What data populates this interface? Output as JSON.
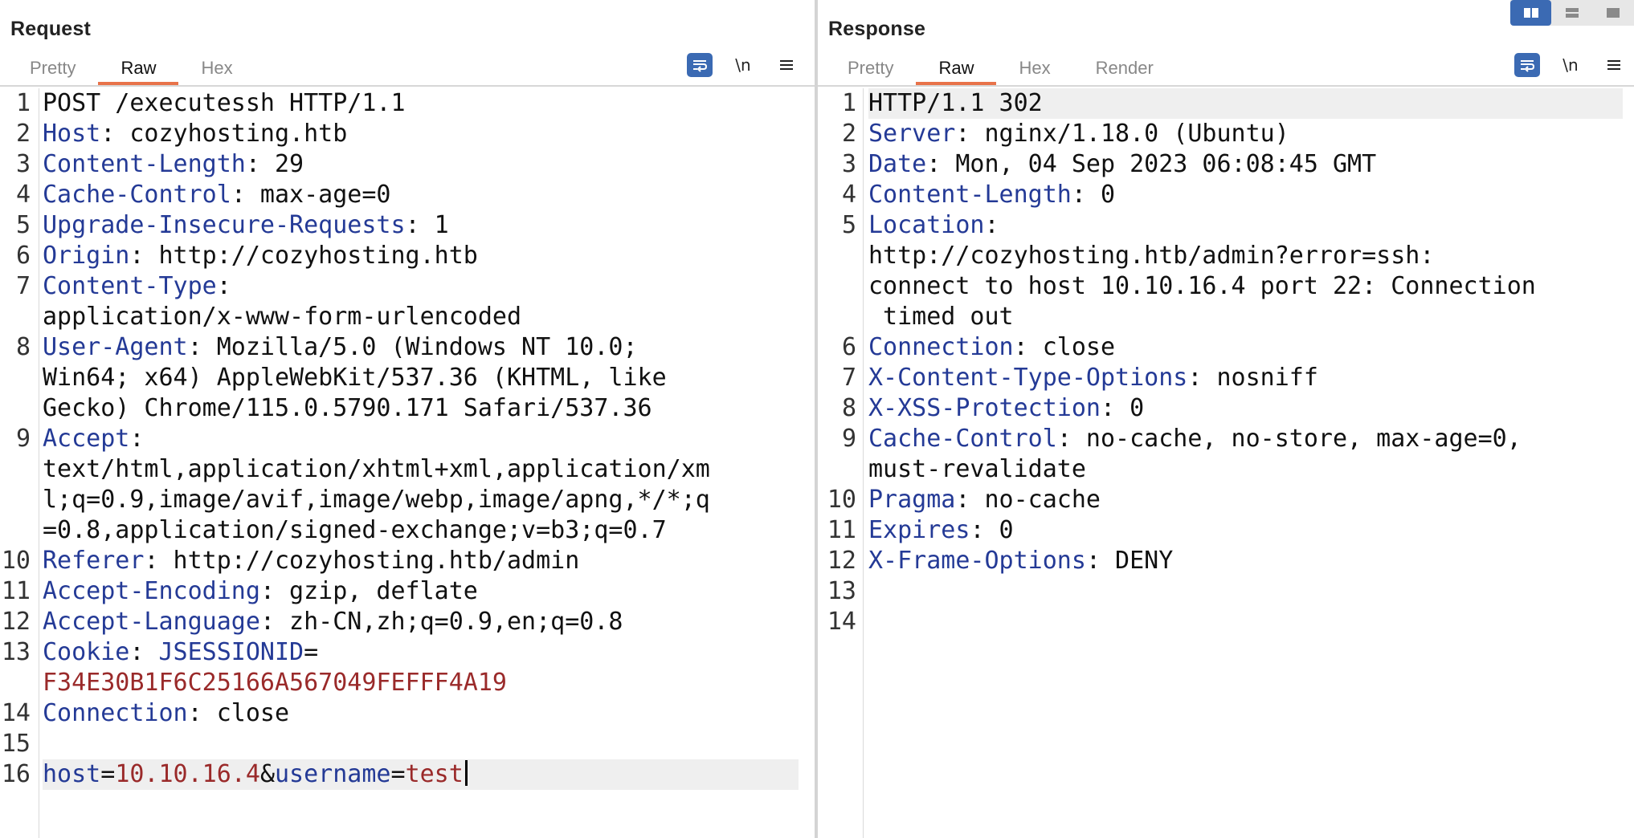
{
  "request": {
    "title": "Request",
    "tabs": [
      {
        "label": "Pretty",
        "active": false
      },
      {
        "label": "Raw",
        "active": true
      },
      {
        "label": "Hex",
        "active": false
      }
    ],
    "toolbar": {
      "wrap_icon": "wrap-lines-icon",
      "newline_label": "\\n",
      "menu_icon": "hamburger-menu-icon"
    },
    "lines": [
      {
        "n": "1",
        "segments": [
          {
            "t": "POST /executessh HTTP/1.1",
            "c": "hv"
          }
        ]
      },
      {
        "n": "2",
        "segments": [
          {
            "t": "Host",
            "c": "hn"
          },
          {
            "t": ": cozyhosting.htb",
            "c": "hv"
          }
        ]
      },
      {
        "n": "3",
        "segments": [
          {
            "t": "Content-Length",
            "c": "hn"
          },
          {
            "t": ": 29",
            "c": "hv"
          }
        ]
      },
      {
        "n": "4",
        "segments": [
          {
            "t": "Cache-Control",
            "c": "hn"
          },
          {
            "t": ": max-age=0",
            "c": "hv"
          }
        ]
      },
      {
        "n": "5",
        "segments": [
          {
            "t": "Upgrade-Insecure-Requests",
            "c": "hn"
          },
          {
            "t": ": 1",
            "c": "hv"
          }
        ]
      },
      {
        "n": "6",
        "segments": [
          {
            "t": "Origin",
            "c": "hn"
          },
          {
            "t": ": http://cozyhosting.htb",
            "c": "hv"
          }
        ]
      },
      {
        "n": "7",
        "segments": [
          {
            "t": "Content-Type",
            "c": "hn"
          },
          {
            "t": ":",
            "c": "hv"
          }
        ]
      },
      {
        "n": "",
        "segments": [
          {
            "t": "application/x-www-form-urlencoded",
            "c": "hv"
          }
        ]
      },
      {
        "n": "8",
        "segments": [
          {
            "t": "User-Agent",
            "c": "hn"
          },
          {
            "t": ": Mozilla/5.0 (Windows NT 10.0;",
            "c": "hv"
          }
        ]
      },
      {
        "n": "",
        "segments": [
          {
            "t": "Win64; x64) AppleWebKit/537.36 (KHTML, like",
            "c": "hv"
          }
        ]
      },
      {
        "n": "",
        "segments": [
          {
            "t": "Gecko) Chrome/115.0.5790.171 Safari/537.36",
            "c": "hv"
          }
        ]
      },
      {
        "n": "9",
        "segments": [
          {
            "t": "Accept",
            "c": "hn"
          },
          {
            "t": ":",
            "c": "hv"
          }
        ]
      },
      {
        "n": "",
        "segments": [
          {
            "t": "text/html,application/xhtml+xml,application/xm",
            "c": "hv"
          }
        ]
      },
      {
        "n": "",
        "segments": [
          {
            "t": "l;q=0.9,image/avif,image/webp,image/apng,*/*;q",
            "c": "hv"
          }
        ]
      },
      {
        "n": "",
        "segments": [
          {
            "t": "=0.8,application/signed-exchange;v=b3;q=0.7",
            "c": "hv"
          }
        ]
      },
      {
        "n": "10",
        "segments": [
          {
            "t": "Referer",
            "c": "hn"
          },
          {
            "t": ": http://cozyhosting.htb/admin",
            "c": "hv"
          }
        ]
      },
      {
        "n": "11",
        "segments": [
          {
            "t": "Accept-Encoding",
            "c": "hn"
          },
          {
            "t": ": gzip, deflate",
            "c": "hv"
          }
        ]
      },
      {
        "n": "12",
        "segments": [
          {
            "t": "Accept-Language",
            "c": "hn"
          },
          {
            "t": ": zh-CN,zh;q=0.9,en;q=0.8",
            "c": "hv"
          }
        ]
      },
      {
        "n": "13",
        "segments": [
          {
            "t": "Cookie",
            "c": "hn"
          },
          {
            "t": ": ",
            "c": "hv"
          },
          {
            "t": "JSESSIONID",
            "c": "ck"
          },
          {
            "t": "=",
            "c": "hv"
          }
        ]
      },
      {
        "n": "",
        "segments": [
          {
            "t": "F34E30B1F6C25166A567049FEFFF4A19",
            "c": "cv"
          }
        ]
      },
      {
        "n": "14",
        "segments": [
          {
            "t": "Connection",
            "c": "hn"
          },
          {
            "t": ": close",
            "c": "hv"
          }
        ]
      },
      {
        "n": "15",
        "segments": []
      },
      {
        "n": "16",
        "highlight": true,
        "caret": true,
        "segments": [
          {
            "t": "host",
            "c": "pk"
          },
          {
            "t": "=",
            "c": "hv"
          },
          {
            "t": "10.10.16.4",
            "c": "pv"
          },
          {
            "t": "&",
            "c": "hv"
          },
          {
            "t": "username",
            "c": "pk"
          },
          {
            "t": "=",
            "c": "hv"
          },
          {
            "t": "test",
            "c": "pv"
          }
        ]
      }
    ]
  },
  "response": {
    "title": "Response",
    "tabs": [
      {
        "label": "Pretty",
        "active": false
      },
      {
        "label": "Raw",
        "active": true
      },
      {
        "label": "Hex",
        "active": false
      },
      {
        "label": "Render",
        "active": false
      }
    ],
    "toolbar": {
      "wrap_icon": "wrap-lines-icon",
      "newline_label": "\\n",
      "menu_icon": "hamburger-menu-icon"
    },
    "lines": [
      {
        "n": "1",
        "highlight": true,
        "segments": [
          {
            "t": "HTTP/1.1 302",
            "c": "hv"
          }
        ]
      },
      {
        "n": "2",
        "segments": [
          {
            "t": "Server",
            "c": "hn"
          },
          {
            "t": ": nginx/1.18.0 (Ubuntu)",
            "c": "hv"
          }
        ]
      },
      {
        "n": "3",
        "segments": [
          {
            "t": "Date",
            "c": "hn"
          },
          {
            "t": ": Mon, 04 Sep 2023 06:08:45 GMT",
            "c": "hv"
          }
        ]
      },
      {
        "n": "4",
        "segments": [
          {
            "t": "Content-Length",
            "c": "hn"
          },
          {
            "t": ": 0",
            "c": "hv"
          }
        ]
      },
      {
        "n": "5",
        "segments": [
          {
            "t": "Location",
            "c": "hn"
          },
          {
            "t": ":",
            "c": "hv"
          }
        ]
      },
      {
        "n": "",
        "segments": [
          {
            "t": "http://cozyhosting.htb/admin?error=ssh:",
            "c": "hv"
          }
        ]
      },
      {
        "n": "",
        "segments": [
          {
            "t": "connect to host 10.10.16.4 port 22: Connection",
            "c": "hv"
          }
        ]
      },
      {
        "n": "",
        "segments": [
          {
            "t": " timed out",
            "c": "hv"
          }
        ]
      },
      {
        "n": "6",
        "segments": [
          {
            "t": "Connection",
            "c": "hn"
          },
          {
            "t": ": close",
            "c": "hv"
          }
        ]
      },
      {
        "n": "7",
        "segments": [
          {
            "t": "X-Content-Type-Options",
            "c": "hn"
          },
          {
            "t": ": nosniff",
            "c": "hv"
          }
        ]
      },
      {
        "n": "8",
        "segments": [
          {
            "t": "X-XSS-Protection",
            "c": "hn"
          },
          {
            "t": ": 0",
            "c": "hv"
          }
        ]
      },
      {
        "n": "9",
        "segments": [
          {
            "t": "Cache-Control",
            "c": "hn"
          },
          {
            "t": ": no-cache, no-store, max-age=0,",
            "c": "hv"
          }
        ]
      },
      {
        "n": "",
        "segments": [
          {
            "t": "must-revalidate",
            "c": "hv"
          }
        ]
      },
      {
        "n": "10",
        "segments": [
          {
            "t": "Pragma",
            "c": "hn"
          },
          {
            "t": ": no-cache",
            "c": "hv"
          }
        ]
      },
      {
        "n": "11",
        "segments": [
          {
            "t": "Expires",
            "c": "hn"
          },
          {
            "t": ": 0",
            "c": "hv"
          }
        ]
      },
      {
        "n": "12",
        "segments": [
          {
            "t": "X-Frame-Options",
            "c": "hn"
          },
          {
            "t": ": DENY",
            "c": "hv"
          }
        ]
      },
      {
        "n": "13",
        "segments": []
      },
      {
        "n": "14",
        "segments": []
      }
    ]
  },
  "layout_controls": {
    "options": [
      {
        "icon": "split-vertical-icon",
        "active": true
      },
      {
        "icon": "split-horizontal-icon",
        "active": false
      },
      {
        "icon": "tabbed-view-icon",
        "active": false
      }
    ]
  },
  "colors": {
    "header_name": "#243a96",
    "header_value": "#111111",
    "param_value": "#9a2a2a",
    "active_tab_underline": "#e8734a",
    "accent_blue": "#3b6ab3"
  }
}
